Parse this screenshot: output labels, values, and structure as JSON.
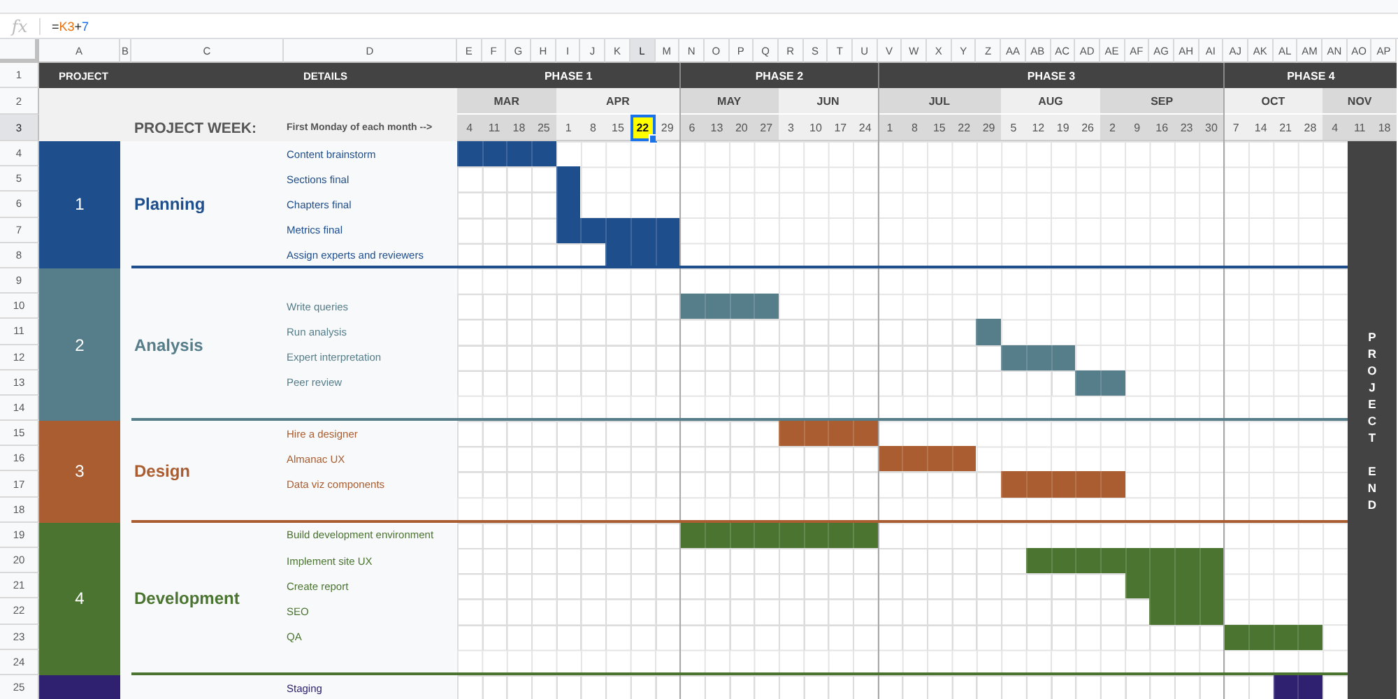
{
  "formula_bar": {
    "label": "fx",
    "parts": [
      {
        "text": "=",
        "kind": "plain"
      },
      {
        "text": "K3",
        "kind": "ref"
      },
      {
        "text": "+",
        "kind": "plain"
      },
      {
        "text": "7",
        "kind": "number"
      }
    ]
  },
  "columns": [
    {
      "label": "A",
      "selected": false
    },
    {
      "label": "B",
      "selected": false
    },
    {
      "label": "C",
      "selected": false
    },
    {
      "label": "D",
      "selected": false
    },
    {
      "label": "E",
      "selected": false
    },
    {
      "label": "F",
      "selected": false
    },
    {
      "label": "G",
      "selected": false
    },
    {
      "label": "H",
      "selected": false
    },
    {
      "label": "I",
      "selected": false
    },
    {
      "label": "J",
      "selected": false
    },
    {
      "label": "K",
      "selected": false
    },
    {
      "label": "L",
      "selected": true
    },
    {
      "label": "M",
      "selected": false
    },
    {
      "label": "N",
      "selected": false
    },
    {
      "label": "O",
      "selected": false
    },
    {
      "label": "P",
      "selected": false
    },
    {
      "label": "Q",
      "selected": false
    },
    {
      "label": "R",
      "selected": false
    },
    {
      "label": "S",
      "selected": false
    },
    {
      "label": "T",
      "selected": false
    },
    {
      "label": "U",
      "selected": false
    },
    {
      "label": "V",
      "selected": false
    },
    {
      "label": "W",
      "selected": false
    },
    {
      "label": "X",
      "selected": false
    },
    {
      "label": "Y",
      "selected": false
    },
    {
      "label": "Z",
      "selected": false
    },
    {
      "label": "AA",
      "selected": false
    },
    {
      "label": "AB",
      "selected": false
    },
    {
      "label": "AC",
      "selected": false
    },
    {
      "label": "AD",
      "selected": false
    },
    {
      "label": "AE",
      "selected": false
    },
    {
      "label": "AF",
      "selected": false
    },
    {
      "label": "AG",
      "selected": false
    },
    {
      "label": "AH",
      "selected": false
    },
    {
      "label": "AI",
      "selected": false
    },
    {
      "label": "AJ",
      "selected": false
    },
    {
      "label": "AK",
      "selected": false
    },
    {
      "label": "AL",
      "selected": false
    },
    {
      "label": "AM",
      "selected": false
    },
    {
      "label": "AN",
      "selected": false
    },
    {
      "label": "AO",
      "selected": false
    },
    {
      "label": "AP",
      "selected": false
    }
  ],
  "rows": [
    {
      "label": "1",
      "selected": false
    },
    {
      "label": "2",
      "selected": false
    },
    {
      "label": "3",
      "selected": true
    },
    {
      "label": "4",
      "selected": false
    },
    {
      "label": "5",
      "selected": false
    },
    {
      "label": "6",
      "selected": false
    },
    {
      "label": "7",
      "selected": false
    },
    {
      "label": "8",
      "selected": false
    },
    {
      "label": "9",
      "selected": false
    },
    {
      "label": "10",
      "selected": false
    },
    {
      "label": "11",
      "selected": false
    },
    {
      "label": "12",
      "selected": false
    },
    {
      "label": "13",
      "selected": false
    },
    {
      "label": "14",
      "selected": false
    },
    {
      "label": "15",
      "selected": false
    },
    {
      "label": "16",
      "selected": false
    },
    {
      "label": "17",
      "selected": false
    },
    {
      "label": "18",
      "selected": false
    },
    {
      "label": "19",
      "selected": false
    },
    {
      "label": "20",
      "selected": false
    },
    {
      "label": "21",
      "selected": false
    },
    {
      "label": "22",
      "selected": false
    },
    {
      "label": "23",
      "selected": false
    },
    {
      "label": "24",
      "selected": false
    },
    {
      "label": "25",
      "selected": false
    }
  ],
  "header": {
    "project": "PROJECT",
    "details": "DETAILS",
    "project_week": "PROJECT WEEK:",
    "week_note": "First Monday of each month -->"
  },
  "phases": [
    {
      "label": "PHASE 1",
      "months": [
        {
          "label": "MAR",
          "weeks": [
            {
              "date": "4",
              "selected": false
            },
            {
              "date": "11",
              "selected": false
            },
            {
              "date": "18",
              "selected": false
            },
            {
              "date": "25",
              "selected": false
            }
          ]
        },
        {
          "label": "APR",
          "weeks": [
            {
              "date": "1",
              "selected": false
            },
            {
              "date": "8",
              "selected": false
            },
            {
              "date": "15",
              "selected": false
            },
            {
              "date": "22",
              "selected": true
            },
            {
              "date": "29",
              "selected": false
            }
          ]
        }
      ]
    },
    {
      "label": "PHASE 2",
      "months": [
        {
          "label": "MAY",
          "weeks": [
            {
              "date": "6",
              "selected": false
            },
            {
              "date": "13",
              "selected": false
            },
            {
              "date": "20",
              "selected": false
            },
            {
              "date": "27",
              "selected": false
            }
          ]
        },
        {
          "label": "JUN",
          "weeks": [
            {
              "date": "3",
              "selected": false
            },
            {
              "date": "10",
              "selected": false
            },
            {
              "date": "17",
              "selected": false
            },
            {
              "date": "24",
              "selected": false
            }
          ]
        }
      ]
    },
    {
      "label": "PHASE 3",
      "months": [
        {
          "label": "JUL",
          "weeks": [
            {
              "date": "1",
              "selected": false
            },
            {
              "date": "8",
              "selected": false
            },
            {
              "date": "15",
              "selected": false
            },
            {
              "date": "22",
              "selected": false
            },
            {
              "date": "29",
              "selected": false
            }
          ]
        },
        {
          "label": "AUG",
          "weeks": [
            {
              "date": "5",
              "selected": false
            },
            {
              "date": "12",
              "selected": false
            },
            {
              "date": "19",
              "selected": false
            },
            {
              "date": "26",
              "selected": false
            }
          ]
        },
        {
          "label": "SEP",
          "weeks": [
            {
              "date": "2",
              "selected": false
            },
            {
              "date": "9",
              "selected": false
            },
            {
              "date": "16",
              "selected": false
            },
            {
              "date": "23",
              "selected": false
            },
            {
              "date": "30",
              "selected": false
            }
          ]
        }
      ]
    },
    {
      "label": "PHASE 4",
      "months": [
        {
          "label": "OCT",
          "weeks": [
            {
              "date": "7",
              "selected": false
            },
            {
              "date": "14",
              "selected": false
            },
            {
              "date": "21",
              "selected": false
            },
            {
              "date": "28",
              "selected": false
            }
          ]
        },
        {
          "label": "NOV",
          "weeks": [
            {
              "date": "4",
              "selected": false
            },
            {
              "date": "11",
              "selected": false
            },
            {
              "date": "18",
              "selected": false
            }
          ]
        }
      ]
    }
  ],
  "projects": [
    {
      "number": "1",
      "name": "Planning",
      "color": "#1f4e8c",
      "rows": [
        {
          "kind": "task",
          "task": "Content brainstorm",
          "week_filled": [
            true,
            true,
            true,
            true
          ]
        },
        {
          "kind": "task",
          "task": "Sections final",
          "week_filled": [
            false,
            false,
            false,
            false,
            true
          ]
        },
        {
          "kind": "task",
          "task": "Chapters final",
          "week_filled": [
            false,
            false,
            false,
            false,
            true
          ]
        },
        {
          "kind": "task",
          "task": "Metrics final",
          "week_filled": [
            false,
            false,
            false,
            false,
            true,
            true,
            true,
            true,
            true
          ]
        },
        {
          "kind": "task",
          "task": "Assign experts and reviewers",
          "week_filled": [
            false,
            false,
            false,
            false,
            false,
            false,
            true,
            true,
            true
          ]
        }
      ]
    },
    {
      "number": "2",
      "name": "Analysis",
      "color": "#567d8a",
      "rows": [
        {
          "kind": "blank"
        },
        {
          "kind": "task",
          "task": "Write queries",
          "week_filled": [
            false,
            false,
            false,
            false,
            false,
            false,
            false,
            false,
            false,
            true,
            true,
            true,
            true
          ]
        },
        {
          "kind": "task",
          "task": "Run analysis",
          "week_filled": [
            false,
            false,
            false,
            false,
            false,
            false,
            false,
            false,
            false,
            false,
            false,
            false,
            false,
            false,
            false,
            false,
            false,
            false,
            false,
            false,
            false,
            true
          ]
        },
        {
          "kind": "task",
          "task": "Expert interpretation",
          "week_filled": [
            false,
            false,
            false,
            false,
            false,
            false,
            false,
            false,
            false,
            false,
            false,
            false,
            false,
            false,
            false,
            false,
            false,
            false,
            false,
            false,
            false,
            false,
            true,
            true,
            true
          ]
        },
        {
          "kind": "task",
          "task": "Peer review",
          "week_filled": [
            false,
            false,
            false,
            false,
            false,
            false,
            false,
            false,
            false,
            false,
            false,
            false,
            false,
            false,
            false,
            false,
            false,
            false,
            false,
            false,
            false,
            false,
            false,
            false,
            false,
            true,
            true
          ]
        },
        {
          "kind": "blank"
        }
      ]
    },
    {
      "number": "3",
      "name": "Design",
      "color": "#a95d30",
      "rows": [
        {
          "kind": "task",
          "task": "Hire a designer",
          "week_filled": [
            false,
            false,
            false,
            false,
            false,
            false,
            false,
            false,
            false,
            false,
            false,
            false,
            false,
            true,
            true,
            true,
            true
          ]
        },
        {
          "kind": "task",
          "task": "Almanac UX",
          "week_filled": [
            false,
            false,
            false,
            false,
            false,
            false,
            false,
            false,
            false,
            false,
            false,
            false,
            false,
            false,
            false,
            false,
            false,
            true,
            true,
            true,
            true
          ]
        },
        {
          "kind": "task",
          "task": "Data viz components",
          "week_filled": [
            false,
            false,
            false,
            false,
            false,
            false,
            false,
            false,
            false,
            false,
            false,
            false,
            false,
            false,
            false,
            false,
            false,
            false,
            false,
            false,
            false,
            false,
            true,
            true,
            true,
            true,
            true
          ]
        },
        {
          "kind": "blank"
        }
      ]
    },
    {
      "number": "4",
      "name": "Development",
      "color": "#4a7430",
      "rows": [
        {
          "kind": "task",
          "task": "Build development environment",
          "week_filled": [
            false,
            false,
            false,
            false,
            false,
            false,
            false,
            false,
            false,
            true,
            true,
            true,
            true,
            true,
            true,
            true,
            true
          ]
        },
        {
          "kind": "task",
          "task": "Implement site UX",
          "week_filled": [
            false,
            false,
            false,
            false,
            false,
            false,
            false,
            false,
            false,
            false,
            false,
            false,
            false,
            false,
            false,
            false,
            false,
            false,
            false,
            false,
            false,
            false,
            false,
            true,
            true,
            true,
            true,
            true,
            true,
            true,
            true
          ]
        },
        {
          "kind": "task",
          "task": "Create report",
          "week_filled": [
            false,
            false,
            false,
            false,
            false,
            false,
            false,
            false,
            false,
            false,
            false,
            false,
            false,
            false,
            false,
            false,
            false,
            false,
            false,
            false,
            false,
            false,
            false,
            false,
            false,
            false,
            false,
            true,
            true,
            true,
            true
          ]
        },
        {
          "kind": "task",
          "task": "SEO",
          "week_filled": [
            false,
            false,
            false,
            false,
            false,
            false,
            false,
            false,
            false,
            false,
            false,
            false,
            false,
            false,
            false,
            false,
            false,
            false,
            false,
            false,
            false,
            false,
            false,
            false,
            false,
            false,
            false,
            false,
            true,
            true,
            true
          ]
        },
        {
          "kind": "task",
          "task": "QA",
          "week_filled": [
            false,
            false,
            false,
            false,
            false,
            false,
            false,
            false,
            false,
            false,
            false,
            false,
            false,
            false,
            false,
            false,
            false,
            false,
            false,
            false,
            false,
            false,
            false,
            false,
            false,
            false,
            false,
            false,
            false,
            false,
            false,
            true,
            true,
            true,
            true
          ]
        },
        {
          "kind": "blank"
        }
      ]
    },
    {
      "color": "#2f2170",
      "rows": [
        {
          "kind": "task",
          "task": "Staging",
          "week_filled": [
            false,
            false,
            false,
            false,
            false,
            false,
            false,
            false,
            false,
            false,
            false,
            false,
            false,
            false,
            false,
            false,
            false,
            false,
            false,
            false,
            false,
            false,
            false,
            false,
            false,
            false,
            false,
            false,
            false,
            false,
            false,
            false,
            false,
            true,
            true
          ]
        }
      ]
    }
  ],
  "project_end": "PROJECT END"
}
